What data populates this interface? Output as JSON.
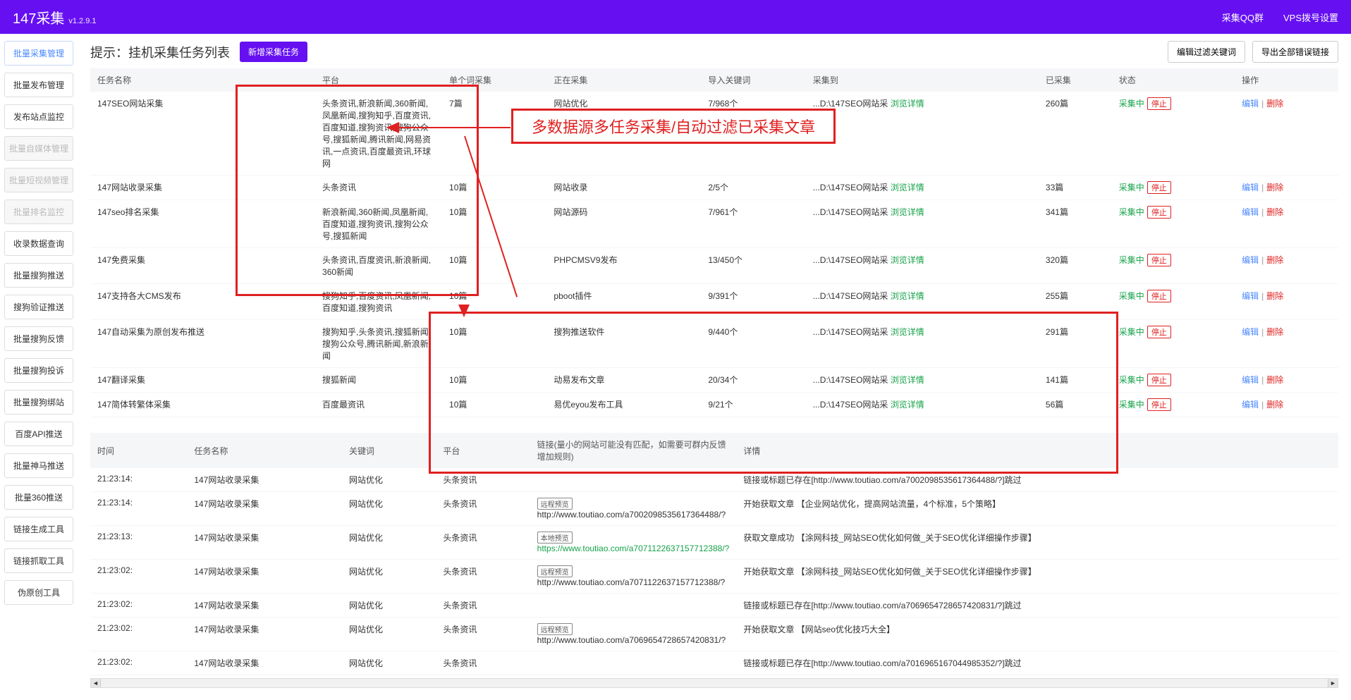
{
  "header": {
    "title": "147采集",
    "version": "v1.2.9.1",
    "links": [
      "采集QQ群",
      "VPS拨号设置"
    ]
  },
  "sidebar": [
    {
      "label": "批量采集管理",
      "state": "active"
    },
    {
      "label": "批量发布管理",
      "state": ""
    },
    {
      "label": "发布站点监控",
      "state": ""
    },
    {
      "label": "批量自媒体管理",
      "state": "disabled"
    },
    {
      "label": "批量短视频管理",
      "state": "disabled"
    },
    {
      "label": "批量排名监控",
      "state": "disabled"
    },
    {
      "label": "收录数据查询",
      "state": ""
    },
    {
      "label": "批量搜狗推送",
      "state": ""
    },
    {
      "label": "搜狗验证推送",
      "state": ""
    },
    {
      "label": "批量搜狗反馈",
      "state": ""
    },
    {
      "label": "批量搜狗投诉",
      "state": ""
    },
    {
      "label": "批量搜狗绑站",
      "state": ""
    },
    {
      "label": "百度API推送",
      "state": ""
    },
    {
      "label": "批量神马推送",
      "state": ""
    },
    {
      "label": "批量360推送",
      "state": ""
    },
    {
      "label": "链接生成工具",
      "state": ""
    },
    {
      "label": "链接抓取工具",
      "state": ""
    },
    {
      "label": "伪原创工具",
      "state": ""
    }
  ],
  "page": {
    "title": "提示：挂机采集任务列表",
    "new_task": "新增采集任务",
    "btn_filter": "编辑过滤关键词",
    "btn_export": "导出全部错误链接"
  },
  "annotation": "多数据源多任务采集/自动过滤已采集文章",
  "tasks": {
    "headers": [
      "任务名称",
      "平台",
      "单个词采集",
      "正在采集",
      "导入关键词",
      "采集到",
      "已采集",
      "状态",
      "操作"
    ],
    "detail_link": "浏览详情",
    "status_txt": "采集中",
    "stop_txt": "停止",
    "edit_txt": "编辑",
    "delete_txt": "删除",
    "rows": [
      {
        "name": "147SEO网站采集",
        "platform": "头条资讯,新浪新闻,360新闻,凤凰新闻,搜狗知乎,百度资讯,百度知道,搜狗资讯,搜狗公众号,搜狐新闻,腾讯新闻,网易资讯,一点资讯,百度最资讯,环球网",
        "single": "7篇",
        "doing": "网站优化",
        "keywords": "7/968个",
        "dest": "...D:\\147SEO网站采",
        "count": "260篇"
      },
      {
        "name": "147网站收录采集",
        "platform": "头条资讯",
        "single": "10篇",
        "doing": "网站收录",
        "keywords": "2/5个",
        "dest": "...D:\\147SEO网站采",
        "count": "33篇"
      },
      {
        "name": "147seo排名采集",
        "platform": "新浪新闻,360新闻,凤凰新闻,百度知道,搜狗资讯,搜狗公众号,搜狐新闻",
        "single": "10篇",
        "doing": "网站源码",
        "keywords": "7/961个",
        "dest": "...D:\\147SEO网站采",
        "count": "341篇"
      },
      {
        "name": "147免费采集",
        "platform": "头条资讯,百度资讯,新浪新闻,360新闻",
        "single": "10篇",
        "doing": "PHPCMSV9发布",
        "keywords": "13/450个",
        "dest": "...D:\\147SEO网站采",
        "count": "320篇"
      },
      {
        "name": "147支持各大CMS发布",
        "platform": "搜狗知乎,百度资讯,凤凰新闻,百度知道,搜狗资讯",
        "single": "10篇",
        "doing": "pboot插件",
        "keywords": "9/391个",
        "dest": "...D:\\147SEO网站采",
        "count": "255篇"
      },
      {
        "name": "147自动采集为原创发布推送",
        "platform": "搜狗知乎,头条资讯,搜狐新闻,搜狗公众号,腾讯新闻,新浪新闻",
        "single": "10篇",
        "doing": "搜狗推送软件",
        "keywords": "9/440个",
        "dest": "...D:\\147SEO网站采",
        "count": "291篇"
      },
      {
        "name": "147翻译采集",
        "platform": "搜狐新闻",
        "single": "10篇",
        "doing": "动易发布文章",
        "keywords": "20/34个",
        "dest": "...D:\\147SEO网站采",
        "count": "141篇"
      },
      {
        "name": "147简体转繁体采集",
        "platform": "百度最资讯",
        "single": "10篇",
        "doing": "易优eyou发布工具",
        "keywords": "9/21个",
        "dest": "...D:\\147SEO网站采",
        "count": "56篇"
      }
    ]
  },
  "logs": {
    "headers": [
      "时间",
      "任务名称",
      "关键词",
      "平台",
      "链接(量小的网站可能没有匹配，如需要可群内反馈增加规则)",
      "详情"
    ],
    "badge_remote": "远程预览",
    "badge_local": "本地预览",
    "rows": [
      {
        "time": "21:23:14:",
        "task": "147网站收录采集",
        "kw": "网站优化",
        "plat": "头条资讯",
        "badge": "",
        "url": "",
        "detail": "链接或标题已存在[http://www.toutiao.com/a7002098535617364488/?]跳过"
      },
      {
        "time": "21:23:14:",
        "task": "147网站收录采集",
        "kw": "网站优化",
        "plat": "头条资讯",
        "badge": "remote",
        "url": "http://www.toutiao.com/a7002098535617364488/?",
        "detail": "开始获取文章 【企业网站优化，提高网站流量，4个标准，5个策略】"
      },
      {
        "time": "21:23:13:",
        "task": "147网站收录采集",
        "kw": "网站优化",
        "plat": "头条资讯",
        "badge": "local",
        "url": "https://www.toutiao.com/a7071122637157712388/?",
        "detail": "获取文章成功 【涂网科技_网站SEO优化如何做_关于SEO优化详细操作步骤】"
      },
      {
        "time": "21:23:02:",
        "task": "147网站收录采集",
        "kw": "网站优化",
        "plat": "头条资讯",
        "badge": "remote",
        "url": "http://www.toutiao.com/a7071122637157712388/?",
        "detail": "开始获取文章 【涂网科技_网站SEO优化如何做_关于SEO优化详细操作步骤】"
      },
      {
        "time": "21:23:02:",
        "task": "147网站收录采集",
        "kw": "网站优化",
        "plat": "头条资讯",
        "badge": "",
        "url": "",
        "detail": "链接或标题已存在[http://www.toutiao.com/a7069654728657420831/?]跳过"
      },
      {
        "time": "21:23:02:",
        "task": "147网站收录采集",
        "kw": "网站优化",
        "plat": "头条资讯",
        "badge": "remote",
        "url": "http://www.toutiao.com/a7069654728657420831/?",
        "detail": "开始获取文章 【网站seo优化技巧大全】"
      },
      {
        "time": "21:23:02:",
        "task": "147网站收录采集",
        "kw": "网站优化",
        "plat": "头条资讯",
        "badge": "",
        "url": "",
        "detail": "链接或标题已存在[http://www.toutiao.com/a7016965167044985352/?]跳过"
      }
    ]
  }
}
